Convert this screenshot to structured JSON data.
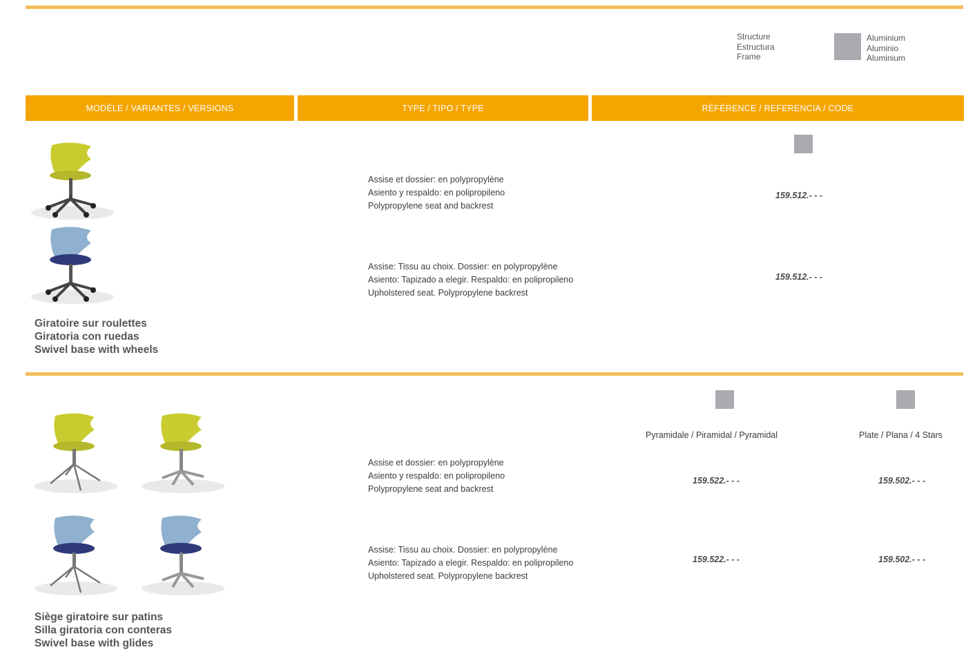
{
  "legend": {
    "structure_label": [
      "Structure",
      "Estructura",
      "Frame"
    ],
    "material": [
      "Aluminium",
      "Aluminio",
      "Aluminium"
    ],
    "swatch_color": "#a9abb0"
  },
  "header": {
    "col1": "MODÈLE / VARIANTES / VERSIONS",
    "col2": "TYPE / TIPO / TYPE",
    "col3": "RÉFÉRENCE / REFERENCIA / CODE",
    "accent": "#f5a500",
    "rule_color": "#f3bd5c"
  },
  "section1": {
    "rows": [
      {
        "desc": [
          "Assise et dossier: en polypropylène",
          "Asiento y respaldo: en polipropileno",
          "Polypropylene seat and backrest"
        ],
        "code": "159.512.- - -"
      },
      {
        "desc": [
          "Assise: Tissu au choix. Dossier: en polypropylène",
          "Asiento: Tapizado a elegir. Respaldo: en polipropileno",
          "Upholstered seat. Polypropylene backrest"
        ],
        "code": "159.512.- - -"
      }
    ],
    "title": [
      "Giratoire sur roulettes",
      "Giratoria con ruedas",
      "Swivel base with wheels"
    ]
  },
  "section2": {
    "base_labels": [
      "Pyramidale / Piramidal / Pyramidal",
      "Plate / Plana / 4 Stars"
    ],
    "rows": [
      {
        "desc": [
          "Assise et dossier: en polypropylène",
          "Asiento y respaldo: en polipropileno",
          "Polypropylene seat and backrest"
        ],
        "codes": [
          "159.522.- - -",
          "159.502.- - -"
        ]
      },
      {
        "desc": [
          "Assise: Tissu au choix. Dossier: en polypropylène",
          "Asiento: Tapizado a elegir. Respaldo: en polipropileno",
          "Upholstered seat. Polypropylene backrest"
        ],
        "codes": [
          "159.522.- - -",
          "159.502.- - -"
        ]
      }
    ],
    "title": [
      "Siège giratoire sur patins",
      "Silla giratoria con conteras",
      "Swivel base with glides"
    ]
  },
  "colors": {
    "yellow_shell": "#c9cc2e",
    "blue_shell": "#8fb0cf",
    "navy_seat": "#2e3a7a"
  }
}
